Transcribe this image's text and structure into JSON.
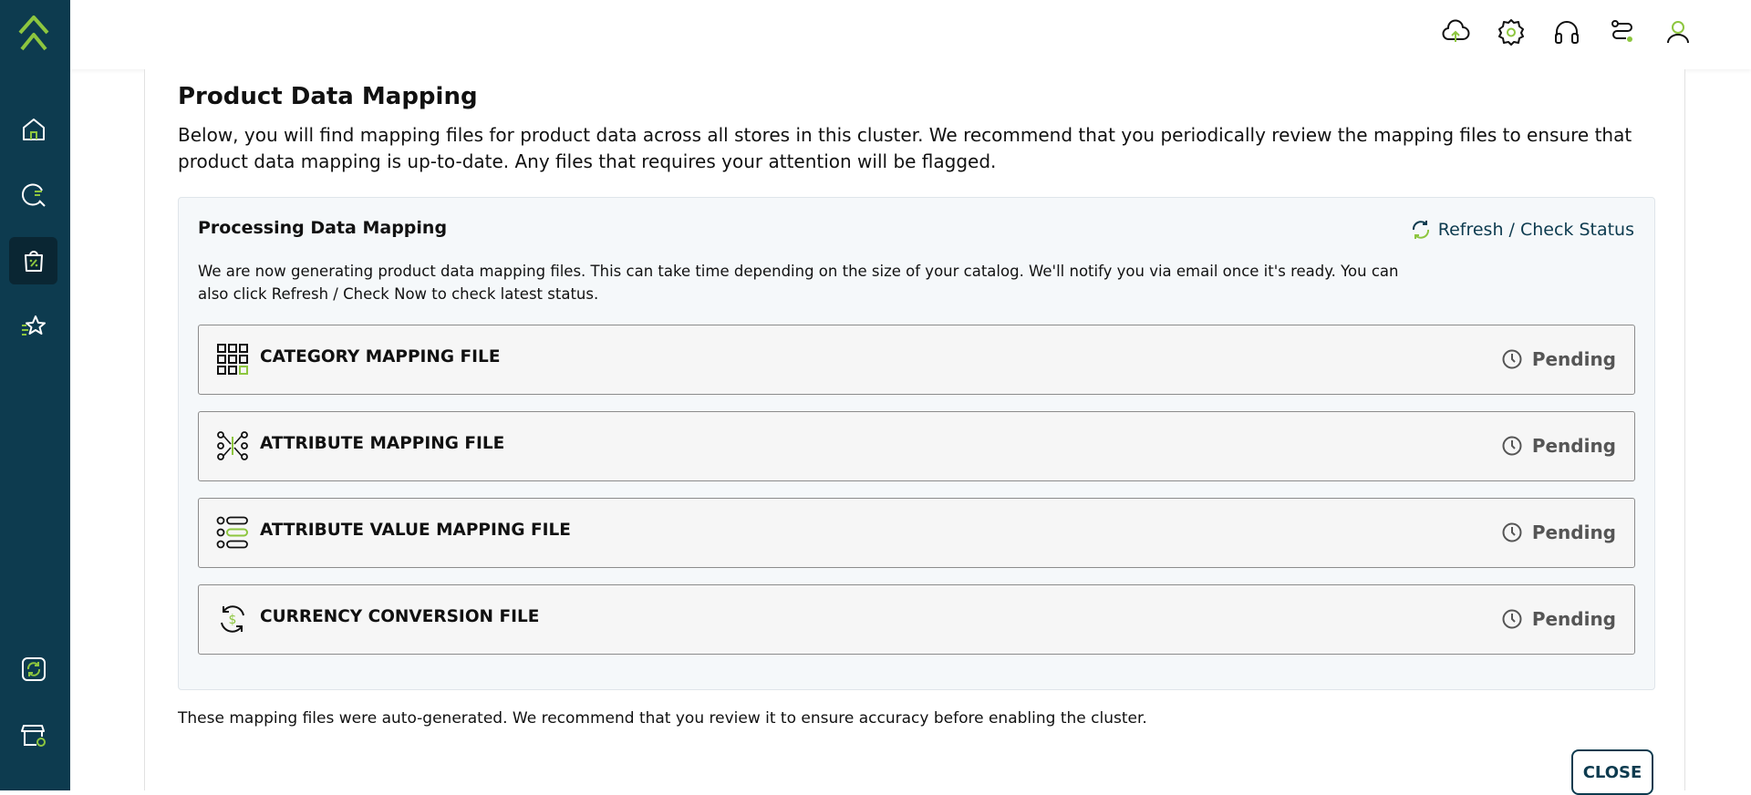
{
  "app": {
    "accent_color": "#8dc63f",
    "sidebar_color": "#0d3b4f"
  },
  "sidebar": {
    "items": [
      {
        "icon": "home-icon"
      },
      {
        "icon": "search-analytics-icon"
      },
      {
        "icon": "product-bag-icon",
        "active": true
      },
      {
        "icon": "star-list-icon"
      },
      {
        "icon": "sync-icon"
      },
      {
        "icon": "store-settings-icon"
      }
    ]
  },
  "topbar": {
    "icons": [
      "cloud-upload-icon",
      "settings-icon",
      "support-headset-icon",
      "route-icon",
      "user-icon"
    ]
  },
  "main": {
    "title": "Product Data Mapping",
    "description": "Below, you will find mapping files for product data across all stores in this cluster. We recommend that you periodically review the mapping files to ensure that product data mapping is up-to-date. Any files that requires your attention will be flagged.",
    "box": {
      "title": "Processing Data Mapping",
      "refresh_label": "Refresh / Check Status",
      "description": "We are now generating product data mapping files. This can take time depending on the size of your catalog. We'll notify you via email once it's ready. You can also click Refresh / Check Now to check latest status.",
      "files": [
        {
          "name": "CATEGORY MAPPING FILE",
          "status": "Pending",
          "icon": "category-grid-icon"
        },
        {
          "name": "ATTRIBUTE MAPPING FILE",
          "status": "Pending",
          "icon": "attribute-network-icon"
        },
        {
          "name": "ATTRIBUTE VALUE MAPPING FILE",
          "status": "Pending",
          "icon": "value-list-icon"
        },
        {
          "name": "CURRENCY CONVERSION FILE",
          "status": "Pending",
          "icon": "currency-icon"
        }
      ]
    },
    "footer_note": "These mapping files were auto-generated. We recommend that you review it to ensure accuracy before enabling the cluster.",
    "close_label": "CLOSE"
  }
}
